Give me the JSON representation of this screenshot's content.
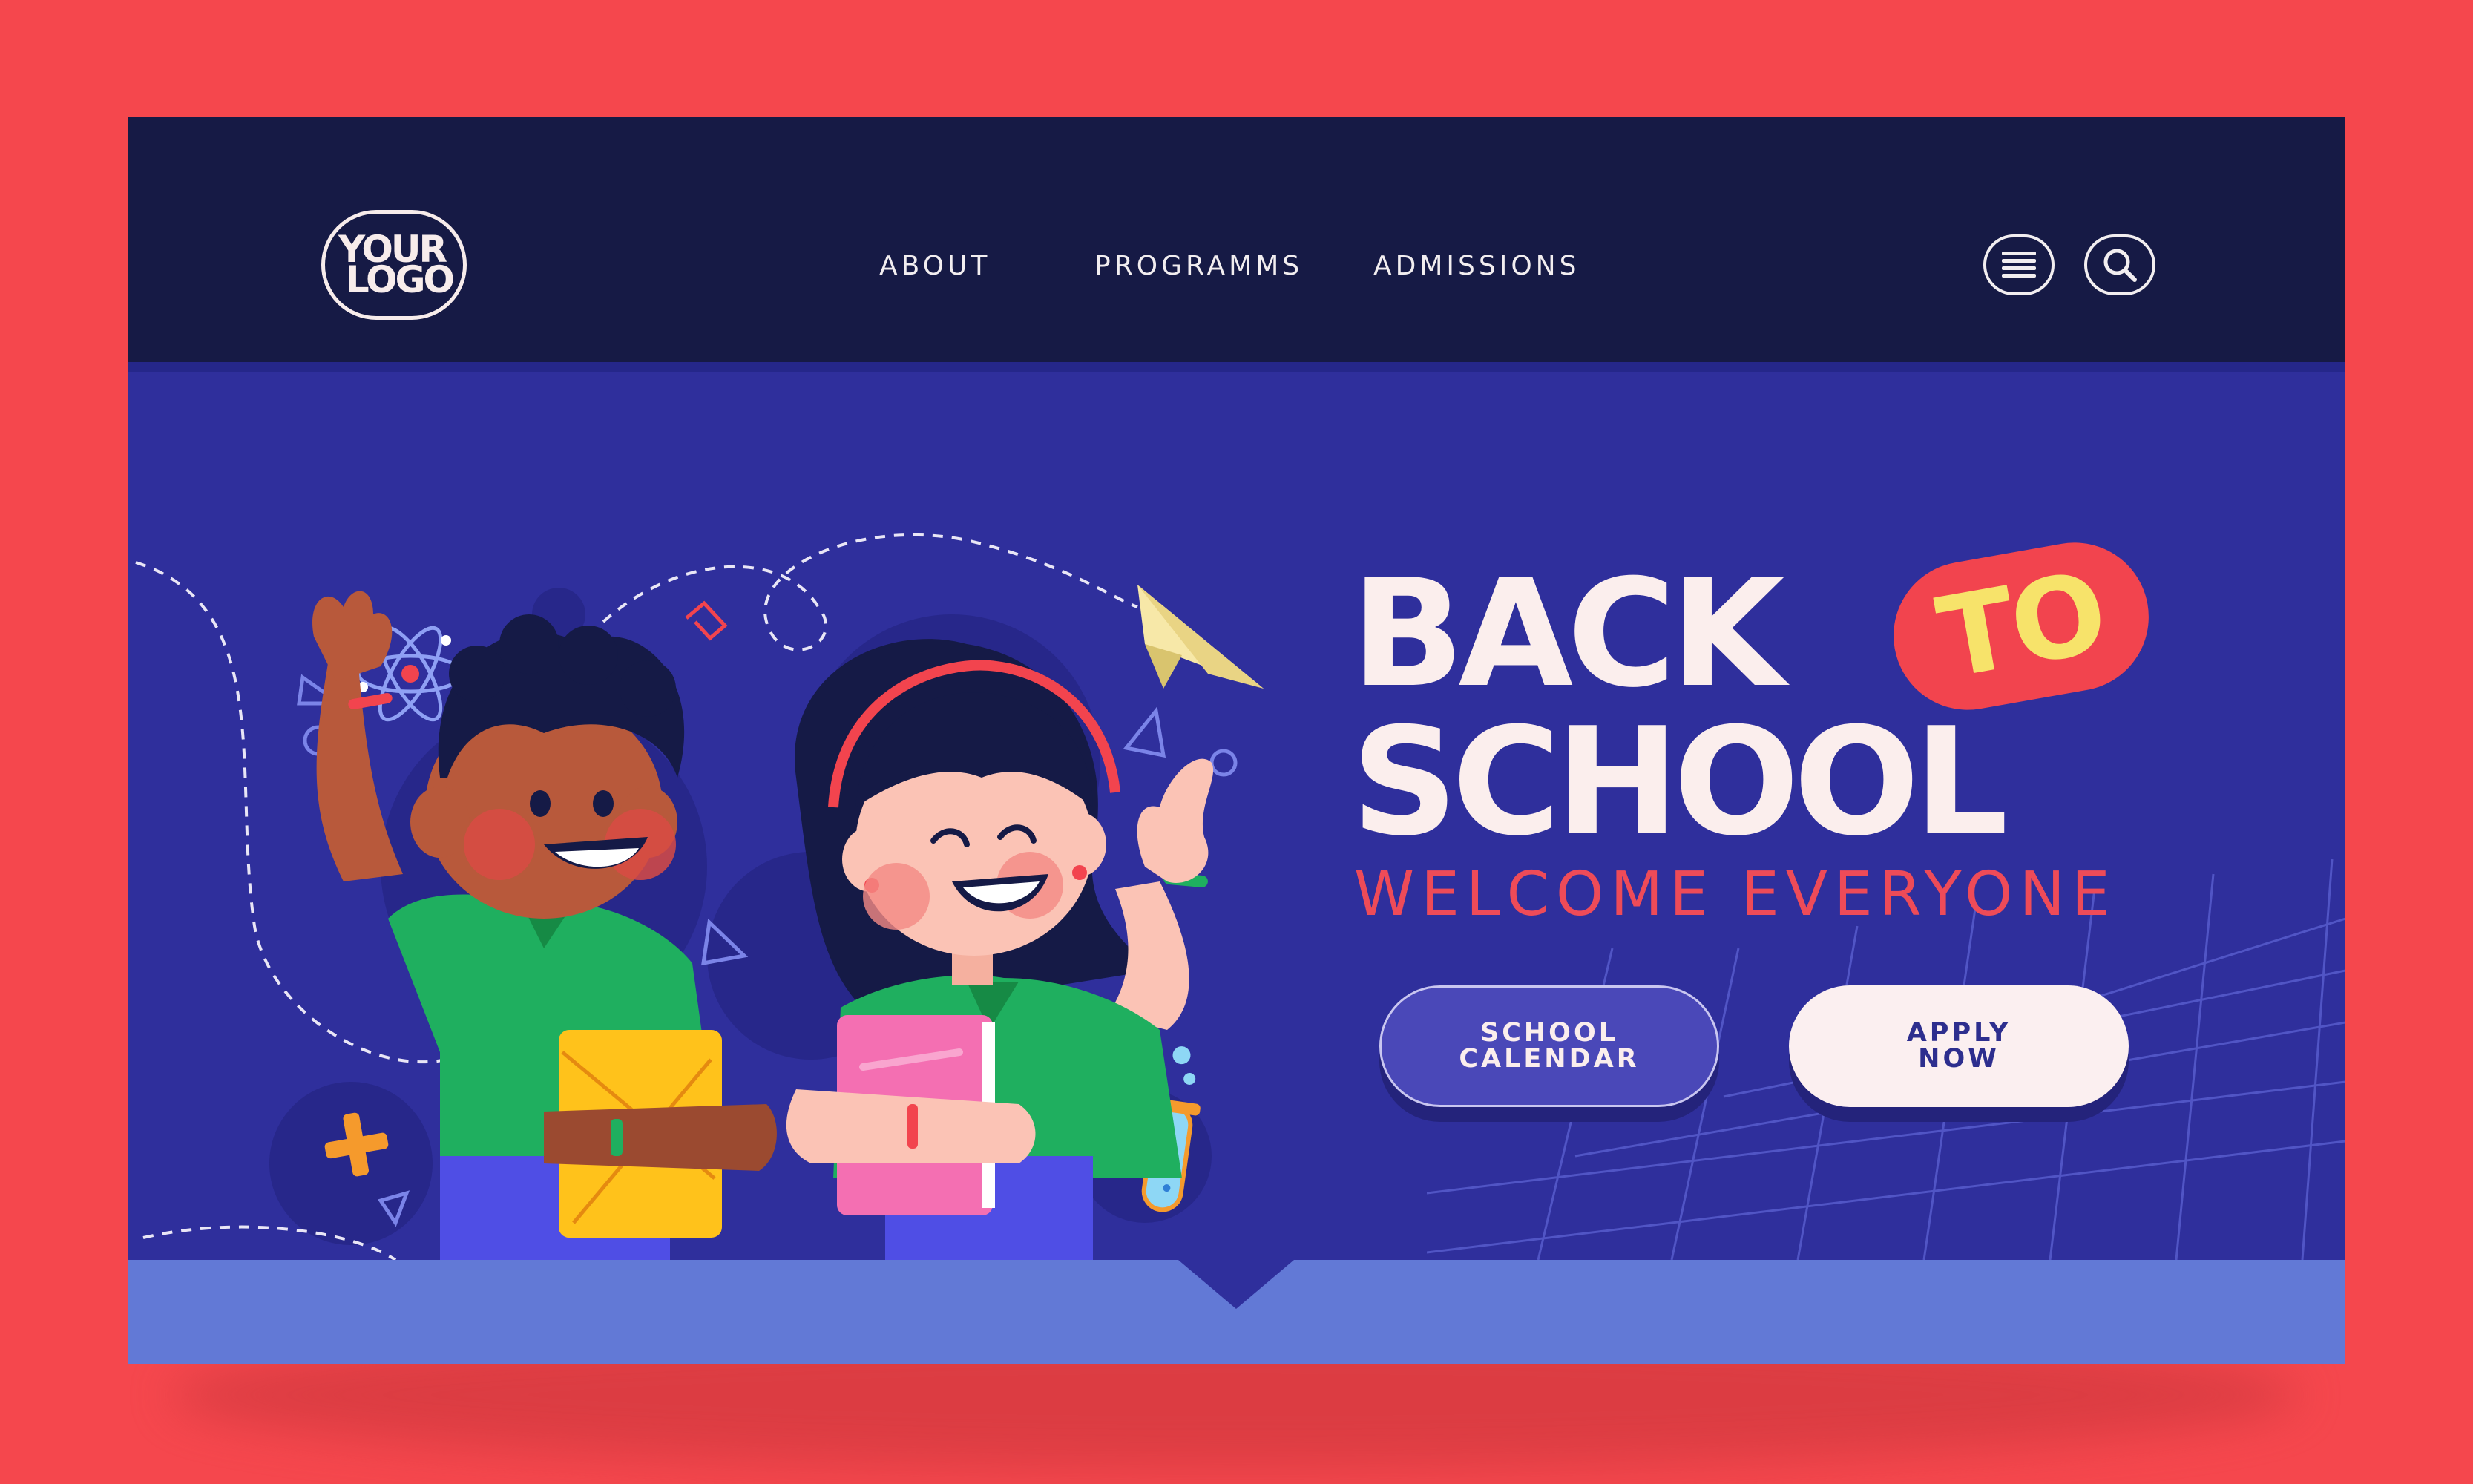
{
  "logo": {
    "line1": "YOUR",
    "line2": "LOGO"
  },
  "nav": {
    "items": [
      {
        "label": "ABOUT"
      },
      {
        "label": "PROGRAMMS"
      },
      {
        "label": "ADMISSIONS"
      }
    ],
    "menu_icon": "hamburger-menu-icon",
    "search_icon": "search-icon"
  },
  "hero": {
    "title_line1": "BACK",
    "title_badge": "TO",
    "title_line2": "SCHOOL",
    "subtitle": "WELCOME EVERYONE"
  },
  "buttons": {
    "calendar_line1": "SCHOOL",
    "calendar_line2": "CALENDAR",
    "apply_line1": "APPLY",
    "apply_line2": "NOW"
  },
  "colors": {
    "page_background": "#f5474d",
    "header_background": "#161a45",
    "hero_background": "#2f2f9c",
    "footer_band": "#6279d6",
    "title_text": "#fbeeed",
    "accent_red": "#f2444e",
    "accent_yellow": "#f7e36a"
  }
}
